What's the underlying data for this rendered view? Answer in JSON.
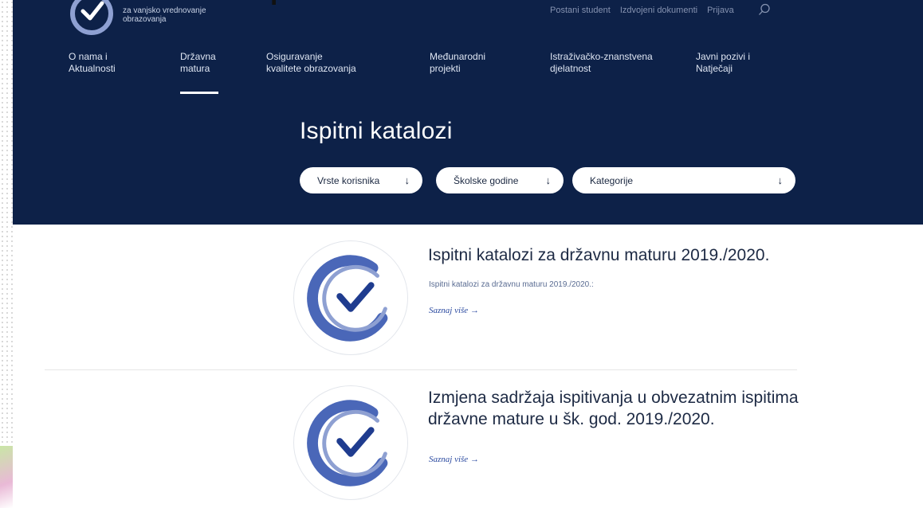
{
  "site": {
    "logo_lines": [
      "za vanjsko vrednovanje",
      "obrazovanja"
    ],
    "clipped_slide_title": "J",
    "util_links": [
      "Postani student",
      "Izdvojeni dokumenti",
      "Prijava"
    ],
    "icons": {
      "search": "search-icon",
      "logo": "logo-mark-icon",
      "card": "checkmark-logo-icon",
      "filter_arrow": "arrow-down-icon",
      "link_arrow": "arrow-right-icon"
    }
  },
  "nav": {
    "items": [
      {
        "label": "O nama i\nAktualnosti"
      },
      {
        "label": "Državna\nmatura"
      },
      {
        "label": "Osiguravanje\nkvalitete obrazovanja"
      },
      {
        "label": "Međunarodni\nprojekti"
      },
      {
        "label": "Istraživačko-znanstvena\ndjelatnost"
      },
      {
        "label": "Javni pozivi i\nNatječaji"
      }
    ],
    "active_index": 1
  },
  "hero": {
    "title": "Ispitni katalozi",
    "filters": [
      {
        "label": "Vrste korisnika",
        "arrow": "↓"
      },
      {
        "label": "Školske godine",
        "arrow": "↓"
      },
      {
        "label": "Kategorije",
        "arrow": "↓"
      }
    ]
  },
  "colors": {
    "header_bg": "#0d2148",
    "accent": "#4a67b8",
    "text": "#1d2a44"
  },
  "results": [
    {
      "title": "Ispitni katalozi za državnu maturu 2019./2020.",
      "description": "Ispitni katalozi za državnu maturu 2019./2020.:",
      "link": "Saznaj više →"
    },
    {
      "title": "Izmjena sadržaja ispitivanja u obvezatnim ispitima državne mature u šk. god. 2019./2020.",
      "description": "",
      "link": "Saznaj više →"
    }
  ]
}
